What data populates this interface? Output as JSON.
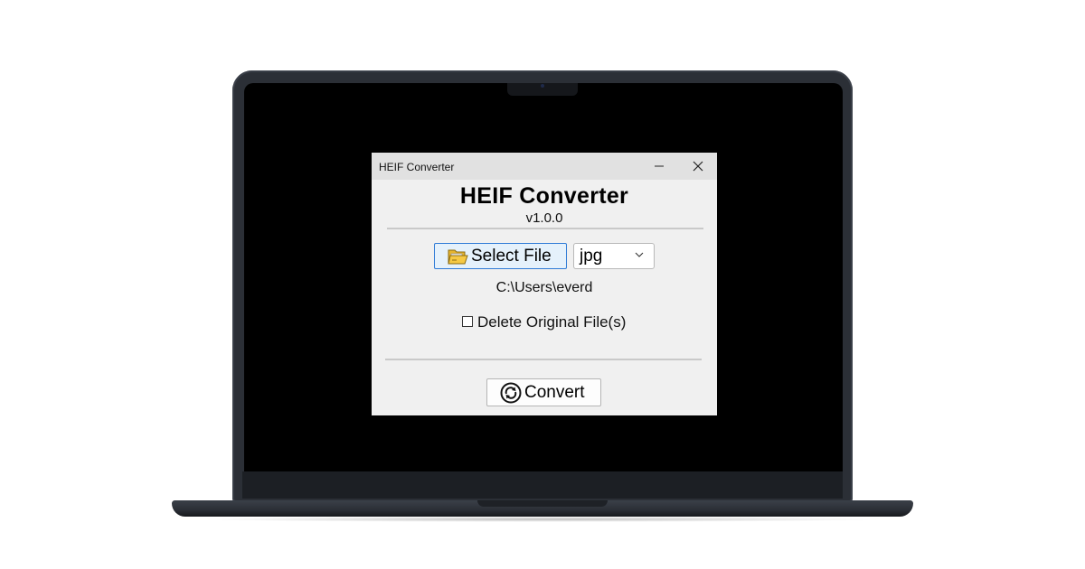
{
  "window": {
    "title": "HEIF Converter"
  },
  "app": {
    "title": "HEIF Converter",
    "version": "v1.0.0"
  },
  "file_picker": {
    "button_label": "Select File",
    "button_icon": "folder-icon",
    "selected_path": "C:\\Users\\everd"
  },
  "format": {
    "selected": "jpg"
  },
  "options": {
    "delete_original_label": "Delete Original File(s)",
    "delete_original_checked": false
  },
  "actions": {
    "convert_label": "Convert",
    "convert_icon": "convert-icon"
  },
  "colors": {
    "accent_border": "#2f7bd6",
    "accent_fill": "#e5f1fb",
    "folder_yellow": "#f6c944"
  }
}
